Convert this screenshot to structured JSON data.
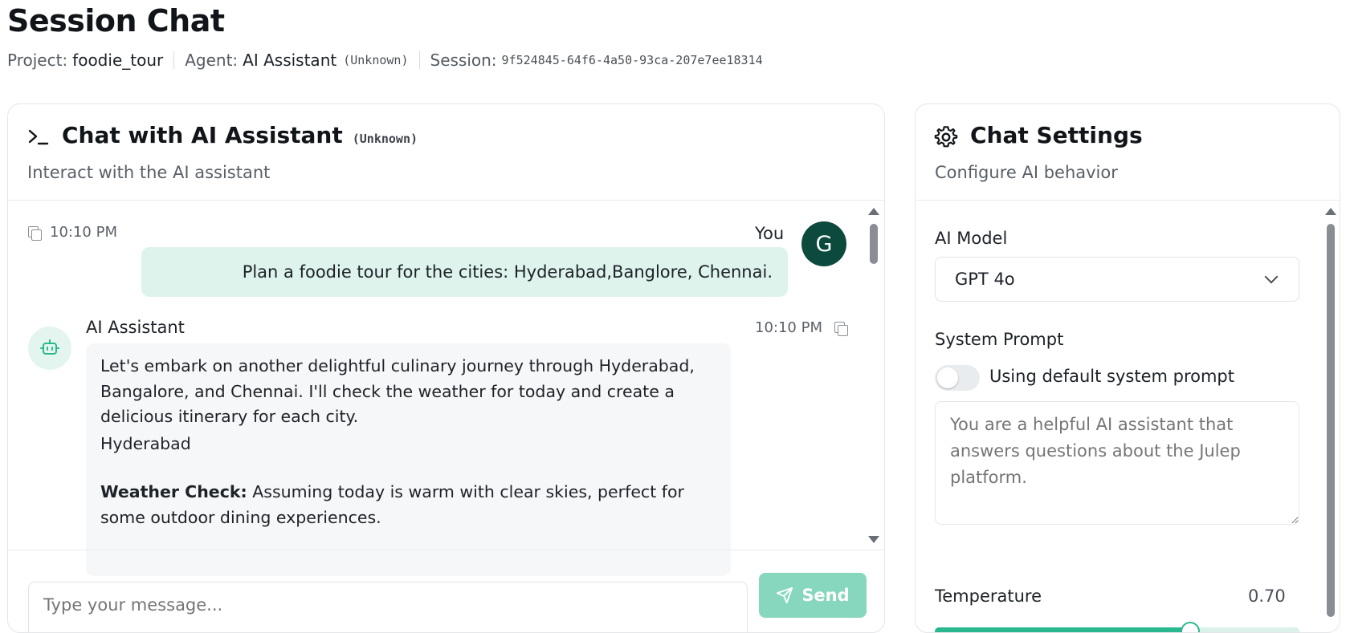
{
  "page": {
    "title": "Session Chat",
    "project_label": "Project:",
    "project_value": "foodie_tour",
    "agent_label": "Agent:",
    "agent_value": "AI Assistant",
    "agent_tag": "(Unknown)",
    "session_label": "Session:",
    "session_value": "9f524845-64f6-4a50-93ca-207e7ee18314"
  },
  "chat": {
    "title": "Chat with AI Assistant",
    "title_tag": "(Unknown)",
    "subtitle": "Interact with the AI assistant",
    "icon": "terminal-icon",
    "messages": [
      {
        "role": "user",
        "sender": "You",
        "avatar_letter": "G",
        "time": "10:10 PM",
        "text": "Plan a foodie tour for the cities: Hyderabad,Banglore, Chennai."
      },
      {
        "role": "assistant",
        "sender": "AI Assistant",
        "time": "10:10 PM",
        "paragraphs": [
          "Let's embark on another delightful culinary journey through Hyderabad, Bangalore, and Chennai. I'll check the weather for today and create a delicious itinerary for each city.",
          "Hyderabad"
        ],
        "weather_label": "Weather Check:",
        "weather_text": "Assuming today is warm with clear skies, perfect for some outdoor dining experiences."
      }
    ],
    "input_placeholder": "Type your message...",
    "send_label": "Send"
  },
  "settings": {
    "title": "Chat Settings",
    "subtitle": "Configure AI behavior",
    "icon": "gear-icon",
    "model_label": "AI Model",
    "model_value": "GPT 4o",
    "system_prompt_label": "System Prompt",
    "system_prompt_toggle_label": "Using default system prompt",
    "system_prompt_toggle_on": false,
    "system_prompt_placeholder": "You are a helpful AI assistant that answers questions about the Julep platform.",
    "temperature_label": "Temperature",
    "temperature_value": "0.70",
    "temperature_fraction": 0.7
  },
  "colors": {
    "accent": "#2bb88f",
    "send_button": "#86d7bd",
    "user_bubble": "#ddf3ec",
    "user_avatar": "#0b4a3c"
  }
}
